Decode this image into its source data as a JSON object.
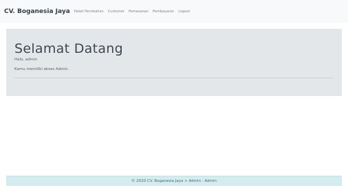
{
  "navbar": {
    "brand": "CV. Boganesia Jaya",
    "links": [
      {
        "label": "Paket Pernikahan"
      },
      {
        "label": "Customer"
      },
      {
        "label": "Pemesanan"
      },
      {
        "label": "Pembayaran"
      },
      {
        "label": "Logout"
      }
    ]
  },
  "jumbotron": {
    "title": "Selamat Datang",
    "greeting": "Halo, admin",
    "access_text": "Kamu memiliki akses Admin."
  },
  "footer": {
    "text": "© 2020 CV. Boganesia Jaya > Admin - Admin"
  },
  "colors": {
    "navbar_bg": "#f8f9fa",
    "jumbotron_bg": "#e4e7ea",
    "footer_bg": "#d2ecf0"
  }
}
